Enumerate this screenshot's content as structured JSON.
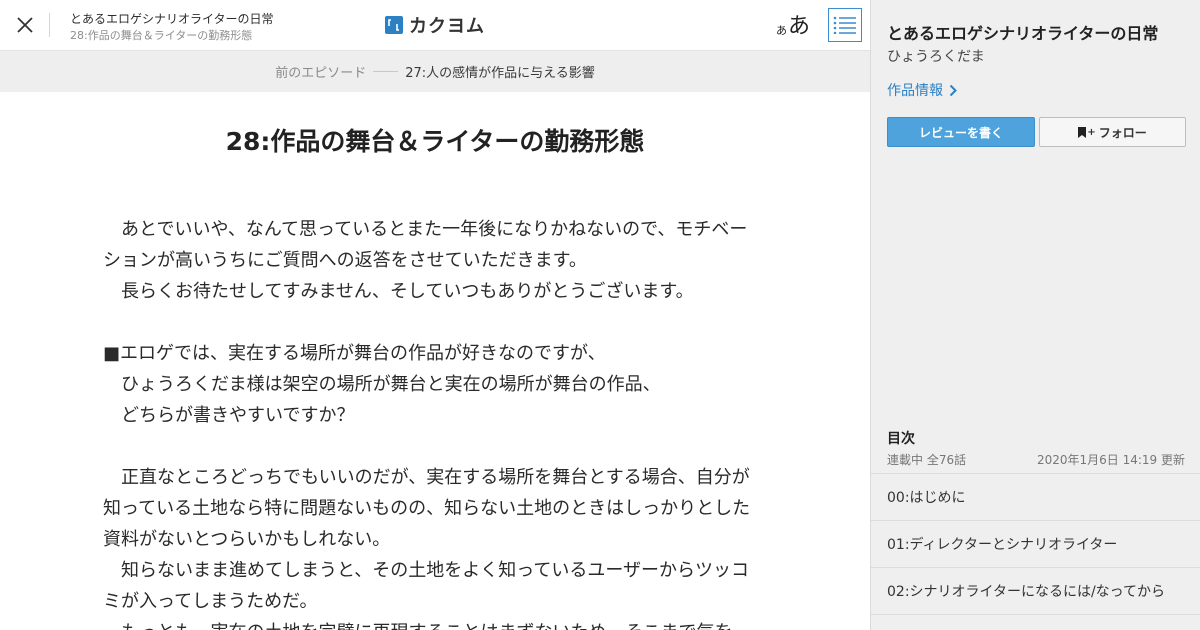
{
  "header": {
    "work_title": "とあるエロゲシナリオライターの日常",
    "episode_title": "28:作品の舞台＆ライターの勤務形態",
    "logo_text": "カクヨム",
    "font_small": "あ",
    "font_large": "あ",
    "icons": {
      "close": "close-icon",
      "logo": "kakuyomu-logo-icon",
      "toc": "list-icon"
    }
  },
  "prev_episode": {
    "label": "前のエピソード",
    "title": "27:人の感情が作品に与える影響"
  },
  "episode": {
    "title": "28:作品の舞台＆ライターの勤務形態",
    "lines": [
      "　あとでいいや、なんて思っているとまた一年後になりかねないので、モチベー",
      "ションが高いうちにご質問への返答をさせていただきます。",
      "　長らくお待たせしてすみません、そしていつもありがとうございます。",
      "",
      "■エロゲでは、実在する場所が舞台の作品が好きなのですが、",
      "　ひょうろくだま様は架空の場所が舞台と実在の場所が舞台の作品、",
      "　どちらが書きやすいですか？",
      "",
      "　正直なところどっちでもいいのだが、実在する場所を舞台とする場合、自分が",
      "知っている土地なら特に問題ないものの、知らない土地のときはしっかりとした",
      "資料がないとつらいかもしれない。",
      "　知らないまま進めてしまうと、その土地をよく知っているユーザーからツッコ",
      "ミが入ってしまうためだ。",
      "　もっとも、実在の土地を完璧に再現することはまずないため、そこまで気を"
    ]
  },
  "sidebar": {
    "work_title": "とあるエロゲシナリオライターの日常",
    "author": "ひょうろくだま",
    "info_link": "作品情報",
    "review_button": "レビューを書く",
    "follow_button": "フォロー",
    "follow_prefix": "+",
    "icons": {
      "info_chevron": "chevron-right-icon",
      "follow": "bookmark-icon"
    },
    "toc": {
      "heading": "目次",
      "status": "連載中 全76話",
      "updated": "2020年1月6日 14:19 更新",
      "items": [
        {
          "label": "00:はじめに"
        },
        {
          "label": "01:ディレクターとシナリオライター"
        },
        {
          "label": "02:シナリオライターになるには/なってから"
        }
      ]
    }
  },
  "colors": {
    "accent": "#2c80c4",
    "review_button": "#4fa3dd",
    "sidebar_bg": "#efefef",
    "prev_bar_bg": "#eeeeee"
  }
}
